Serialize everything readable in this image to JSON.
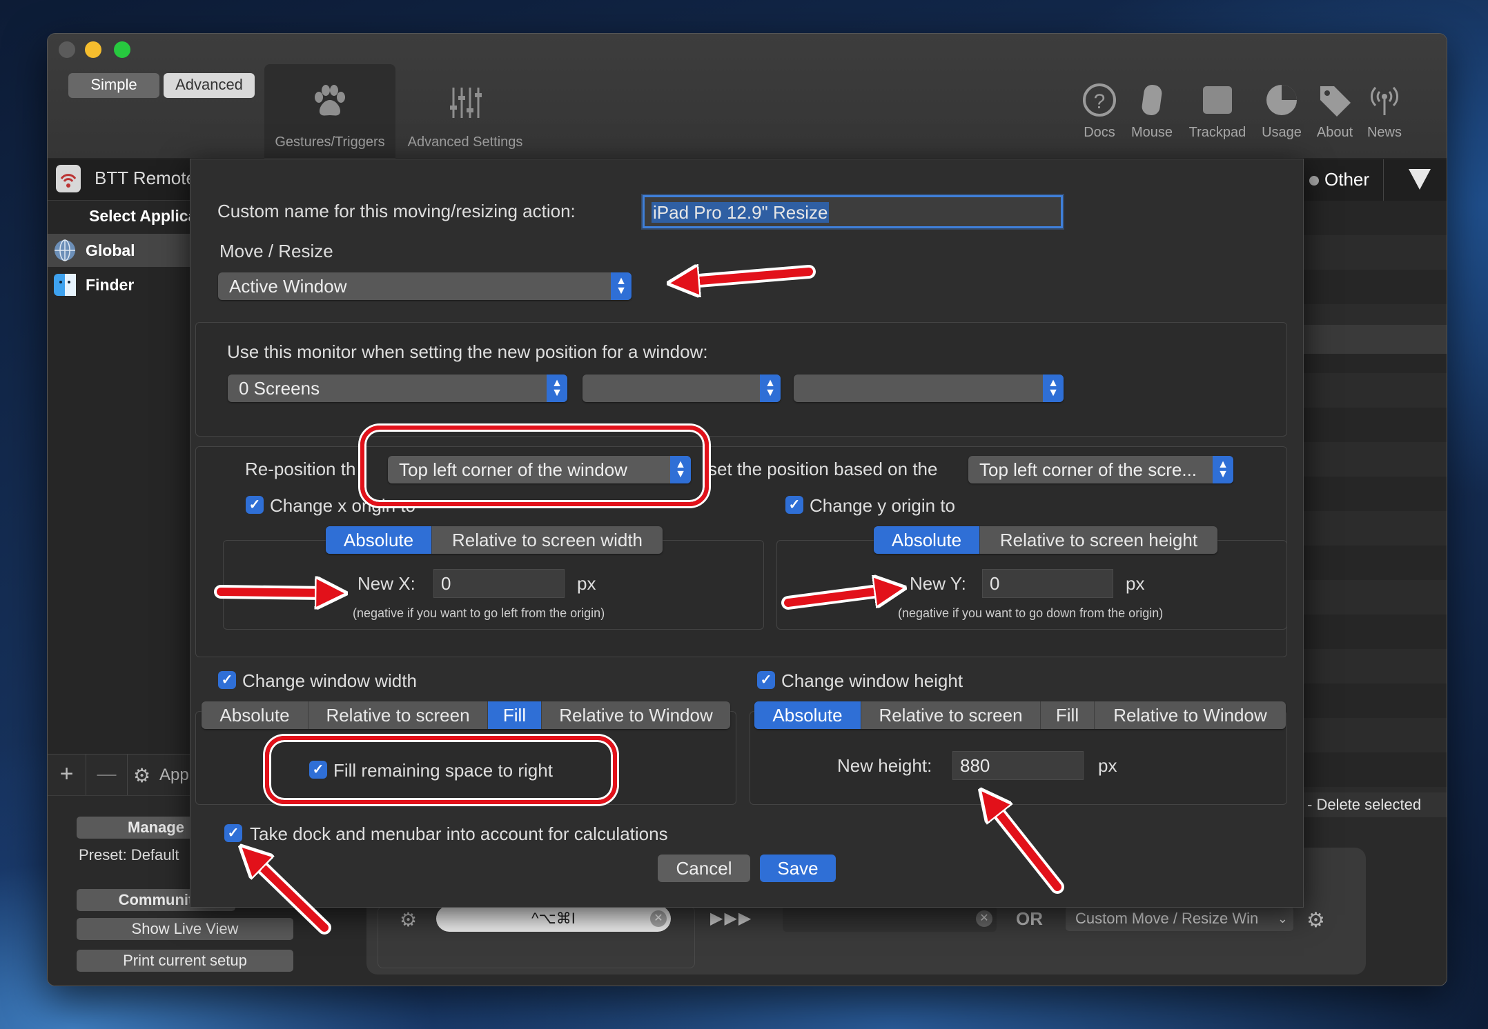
{
  "window": {
    "mode_simple": "Simple",
    "mode_advanced": "Advanced",
    "toolbar_tabs": [
      {
        "label": "Gestures/Triggers",
        "icon": "paw-icon"
      },
      {
        "label": "Advanced Settings",
        "icon": "sliders-icon"
      }
    ],
    "toolbar_right": [
      {
        "label": "Docs",
        "icon": "question-icon",
        "glyph": "?"
      },
      {
        "label": "Mouse",
        "icon": "mouse-icon",
        "glyph": ""
      },
      {
        "label": "Trackpad",
        "icon": "trackpad-icon",
        "glyph": ""
      },
      {
        "label": "Usage",
        "icon": "pie-chart-icon",
        "glyph": ""
      },
      {
        "label": "About",
        "icon": "tag-icon",
        "glyph": ""
      },
      {
        "label": "News",
        "icon": "antenna-icon",
        "glyph": ""
      }
    ],
    "app_header": "BTT Remote",
    "select_app": "Select Applica",
    "sidebar_items": [
      {
        "label": "Global",
        "icon": "globe-icon"
      },
      {
        "label": "Finder",
        "icon": "finder-icon"
      }
    ],
    "other_label": "Other",
    "bottom_plus": "+",
    "bottom_minus": "—",
    "bottom_app": "App",
    "manage": "Manage",
    "preset": "Preset: Default",
    "community": "Communit",
    "show_live_view": "Show Live View",
    "print_setup": "Print current setup",
    "delete_selected": "- Delete selected",
    "shortcut": "^⌥⌘I",
    "play": "▶▶▶",
    "or": "OR",
    "custom_action": "Custom Move / Resize Win"
  },
  "dialog": {
    "name_label": "Custom name for this moving/resizing action:",
    "name_value": "iPad Pro 12.9\" Resize",
    "move_resize_label": "Move / Resize",
    "target_value": "Active Window",
    "monitor_label": "Use this monitor when setting the new position for a window:",
    "monitor_value": "0 Screens",
    "monitor_value2": "",
    "monitor_value3": "",
    "reposition_label": "Re-position th",
    "reposition_value": "Top left corner of the window",
    "based_on_label": "set the position based on the",
    "based_on_value": "Top left corner of the scre...",
    "change_x_label": "Change x origin to",
    "change_y_label": "Change y origin to",
    "x_modes": [
      "Absolute",
      "Relative to screen width"
    ],
    "y_modes": [
      "Absolute",
      "Relative to screen height"
    ],
    "new_x_label": "New X:",
    "new_x_value": "0",
    "px": "px",
    "new_x_hint": "(negative if you want to go left from the origin)",
    "new_y_label": "New Y:",
    "new_y_value": "0",
    "new_y_hint": "(negative if you want to go down from the origin)",
    "width_label": "Change window width",
    "width_modes": [
      "Absolute",
      "Relative to screen",
      "Fill",
      "Relative to Window"
    ],
    "width_selected": "Fill",
    "fill_label": "Fill remaining space to right",
    "height_label": "Change window height",
    "height_modes": [
      "Absolute",
      "Relative to screen",
      "Fill",
      "Relative to Window"
    ],
    "height_selected": "Absolute",
    "new_height_label": "New height:",
    "new_height_value": "880",
    "dock_label": "Take dock and menubar into account for calculations",
    "cancel": "Cancel",
    "save": "Save"
  },
  "colors": {
    "accent": "#2f6fd6",
    "annotation_red": "#e2111a"
  }
}
